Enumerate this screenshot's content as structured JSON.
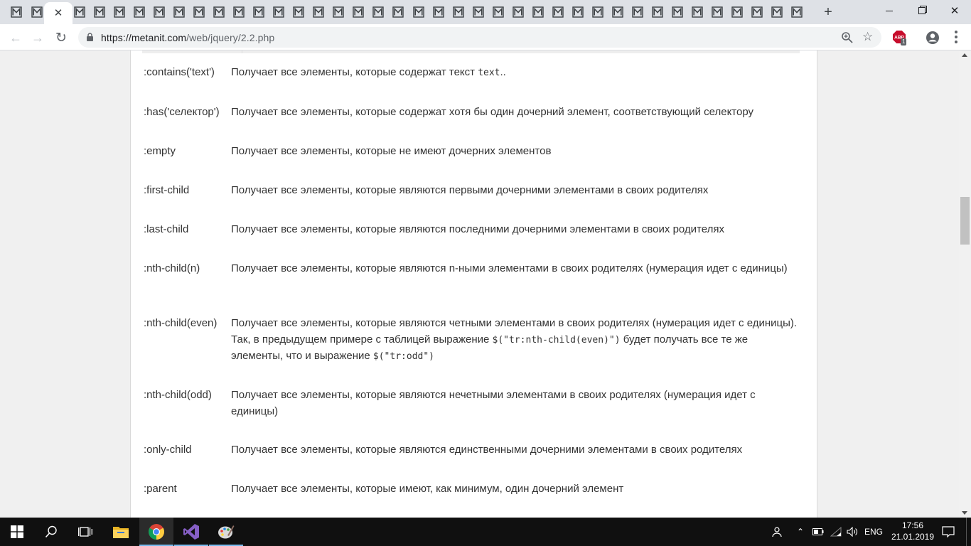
{
  "browser": {
    "tab_count_inactive_left": 2,
    "tab_count_inactive_right": 37,
    "active_tab_close": "✕",
    "new_tab": "+",
    "window_controls": {
      "minimize": "—",
      "maximize": "❐",
      "close": "✕"
    },
    "url_host": "https://metanit.com",
    "url_path": "/web/jquery/2.2.php",
    "extension_badge": "1",
    "accent_color": "#1a73e8"
  },
  "selectors": [
    {
      "name": ":contains('text')",
      "desc_before": "Получает все элементы, которые содержат текст ",
      "code1": "text",
      "desc_after": ".."
    },
    {
      "name": ":has('селектор')",
      "desc_before": "Получает все элементы, которые содержат хотя бы один дочерний элемент, соответствующий селектору"
    },
    {
      "name": ":empty",
      "desc_before": "Получает все элементы, которые не имеют дочерних элементов"
    },
    {
      "name": ":first-child",
      "desc_before": "Получает все элементы, которые являются первыми дочерними элементами в своих родителях"
    },
    {
      "name": ":last-child",
      "desc_before": "Получает все элементы, которые являются последними дочерними элементами в своих родителях"
    },
    {
      "name": ":nth-child(n)",
      "desc_before": "Получает все элементы, которые являются n-ными элементами в своих родителях (нумерация идет с единицы)"
    },
    {
      "name": ":nth-child(even)",
      "desc_before": "Получает все элементы, которые являются четными элементами в своих родителях (нумерация идет с единицы). Так, в предыдущем примере с таблицей выражение ",
      "code1": "$(\"tr:nth-child(even)\")",
      "desc_mid": " будет получать все те же элементы, что и выражение ",
      "code2": "$(\"tr:odd\")"
    },
    {
      "name": ":nth-child(odd)",
      "desc_before": "Получает все элементы, которые являются нечетными элементами в своих родителях (нумерация идет с единицы)"
    },
    {
      "name": ":only-child",
      "desc_before": "Получает все элементы, которые являются единственными дочерними элементами в своих родителях"
    },
    {
      "name": ":parent",
      "desc_before": "Получает все элементы, которые имеют, как минимум, один дочерний элемент"
    }
  ],
  "taskbar": {
    "apps": [
      "start-icon",
      "search-icon",
      "task-view-icon",
      "file-explorer-icon",
      "chrome-icon",
      "visual-studio-icon",
      "paint-icon"
    ],
    "language": "ENG",
    "time": "17:56",
    "date": "21.01.2019"
  }
}
